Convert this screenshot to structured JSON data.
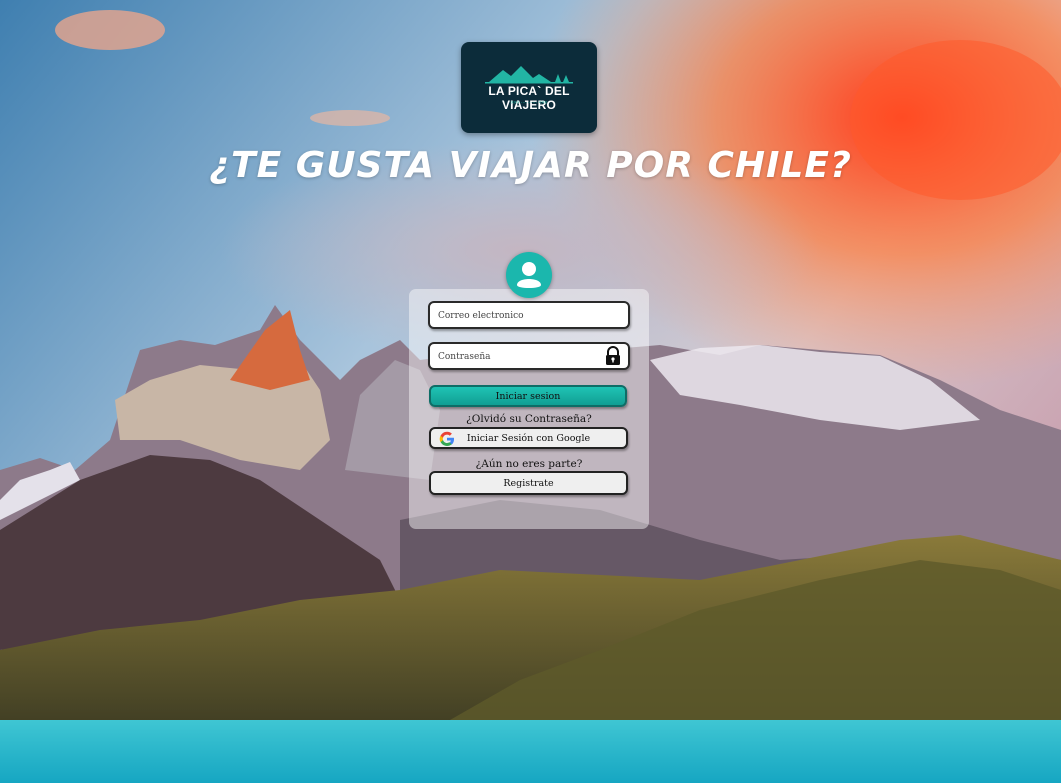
{
  "logo": {
    "brand": "LA PICA` DEL VIAJERO",
    "tagline": ">>> ·········· <<<",
    "colors": {
      "bg": "#0c2c3a",
      "accent": "#22b5a4"
    }
  },
  "headline": "¿TE GUSTA VIAJAR POR CHILE?",
  "login": {
    "avatar_icon": "user-icon",
    "email_placeholder": "Correo electronico",
    "password_placeholder": "Contraseña",
    "password_icon": "lock-icon",
    "submit_label": "Iniciar sesion",
    "forgot_label": "¿Olvidó su Contraseña?",
    "google_label": "Iniciar Sesión con Google",
    "google_icon": "google-icon",
    "signup_prompt": "¿Aún no eres parte?",
    "register_label": "Registrate"
  },
  "colors": {
    "accent": "#1bb7ad",
    "card": "rgba(255,255,255,0.45)"
  }
}
